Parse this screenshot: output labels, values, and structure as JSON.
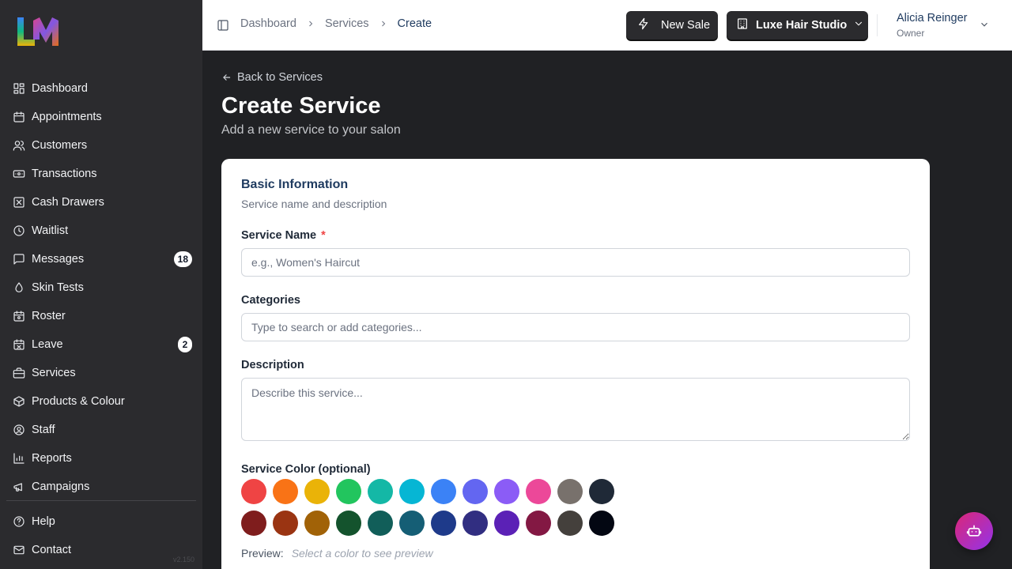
{
  "sidebar": {
    "logo_alt": "LM",
    "items": [
      {
        "label": "Dashboard",
        "icon": "dashboard-icon"
      },
      {
        "label": "Appointments",
        "icon": "calendar-icon"
      },
      {
        "label": "Customers",
        "icon": "users-icon"
      },
      {
        "label": "Transactions",
        "icon": "banknote-icon"
      },
      {
        "label": "Cash Drawers",
        "icon": "drawer-icon"
      },
      {
        "label": "Waitlist",
        "icon": "clock-icon"
      },
      {
        "label": "Messages",
        "icon": "message-icon",
        "badge": "18"
      },
      {
        "label": "Skin Tests",
        "icon": "droplet-icon"
      },
      {
        "label": "Roster",
        "icon": "roster-icon"
      },
      {
        "label": "Leave",
        "icon": "calendar-off-icon",
        "badge": "2"
      },
      {
        "label": "Services",
        "icon": "briefcase-icon"
      },
      {
        "label": "Products & Colour",
        "icon": "package-icon"
      },
      {
        "label": "Staff",
        "icon": "user-circle-icon"
      },
      {
        "label": "Reports",
        "icon": "chart-icon"
      },
      {
        "label": "Campaigns",
        "icon": "megaphone-icon"
      }
    ],
    "bottom_items": [
      {
        "label": "Help",
        "icon": "help-icon"
      },
      {
        "label": "Contact",
        "icon": "mail-icon"
      }
    ],
    "version": "v2.150"
  },
  "header": {
    "breadcrumbs": [
      "Dashboard",
      "Services",
      "Create"
    ],
    "new_sale_label": "New Sale",
    "studio_label": "Luxe Hair Studio",
    "user_name": "Alicia Reinger",
    "user_role": "Owner"
  },
  "main": {
    "back_label": "Back to Services",
    "title": "Create Service",
    "subtitle": "Add a new service to your salon"
  },
  "form": {
    "section_title": "Basic Information",
    "section_subtitle": "Service name and description",
    "name_label": "Service Name",
    "name_required": "*",
    "name_placeholder": "e.g., Women's Haircut",
    "name_value": "",
    "categories_label": "Categories",
    "categories_placeholder": "Type to search or add categories...",
    "description_label": "Description",
    "description_placeholder": "Describe this service...",
    "color_label": "Service Color (optional)",
    "colors_row1": [
      "#ef4444",
      "#f97316",
      "#eab308",
      "#22c55e",
      "#14b8a6",
      "#06b6d4",
      "#3b82f6",
      "#6366f1",
      "#8b5cf6",
      "#ec4899",
      "#78716c",
      "#1f2937"
    ],
    "colors_row2": [
      "#7f1d1d",
      "#9a3412",
      "#a16207",
      "#14532d",
      "#115e59",
      "#155e75",
      "#1e3a8a",
      "#312e81",
      "#5b21b6",
      "#831843",
      "#44403c",
      "#030712"
    ],
    "preview_label": "Preview:",
    "preview_placeholder": "Select a color to see preview"
  },
  "assistant": {
    "icon": "bot-icon"
  }
}
